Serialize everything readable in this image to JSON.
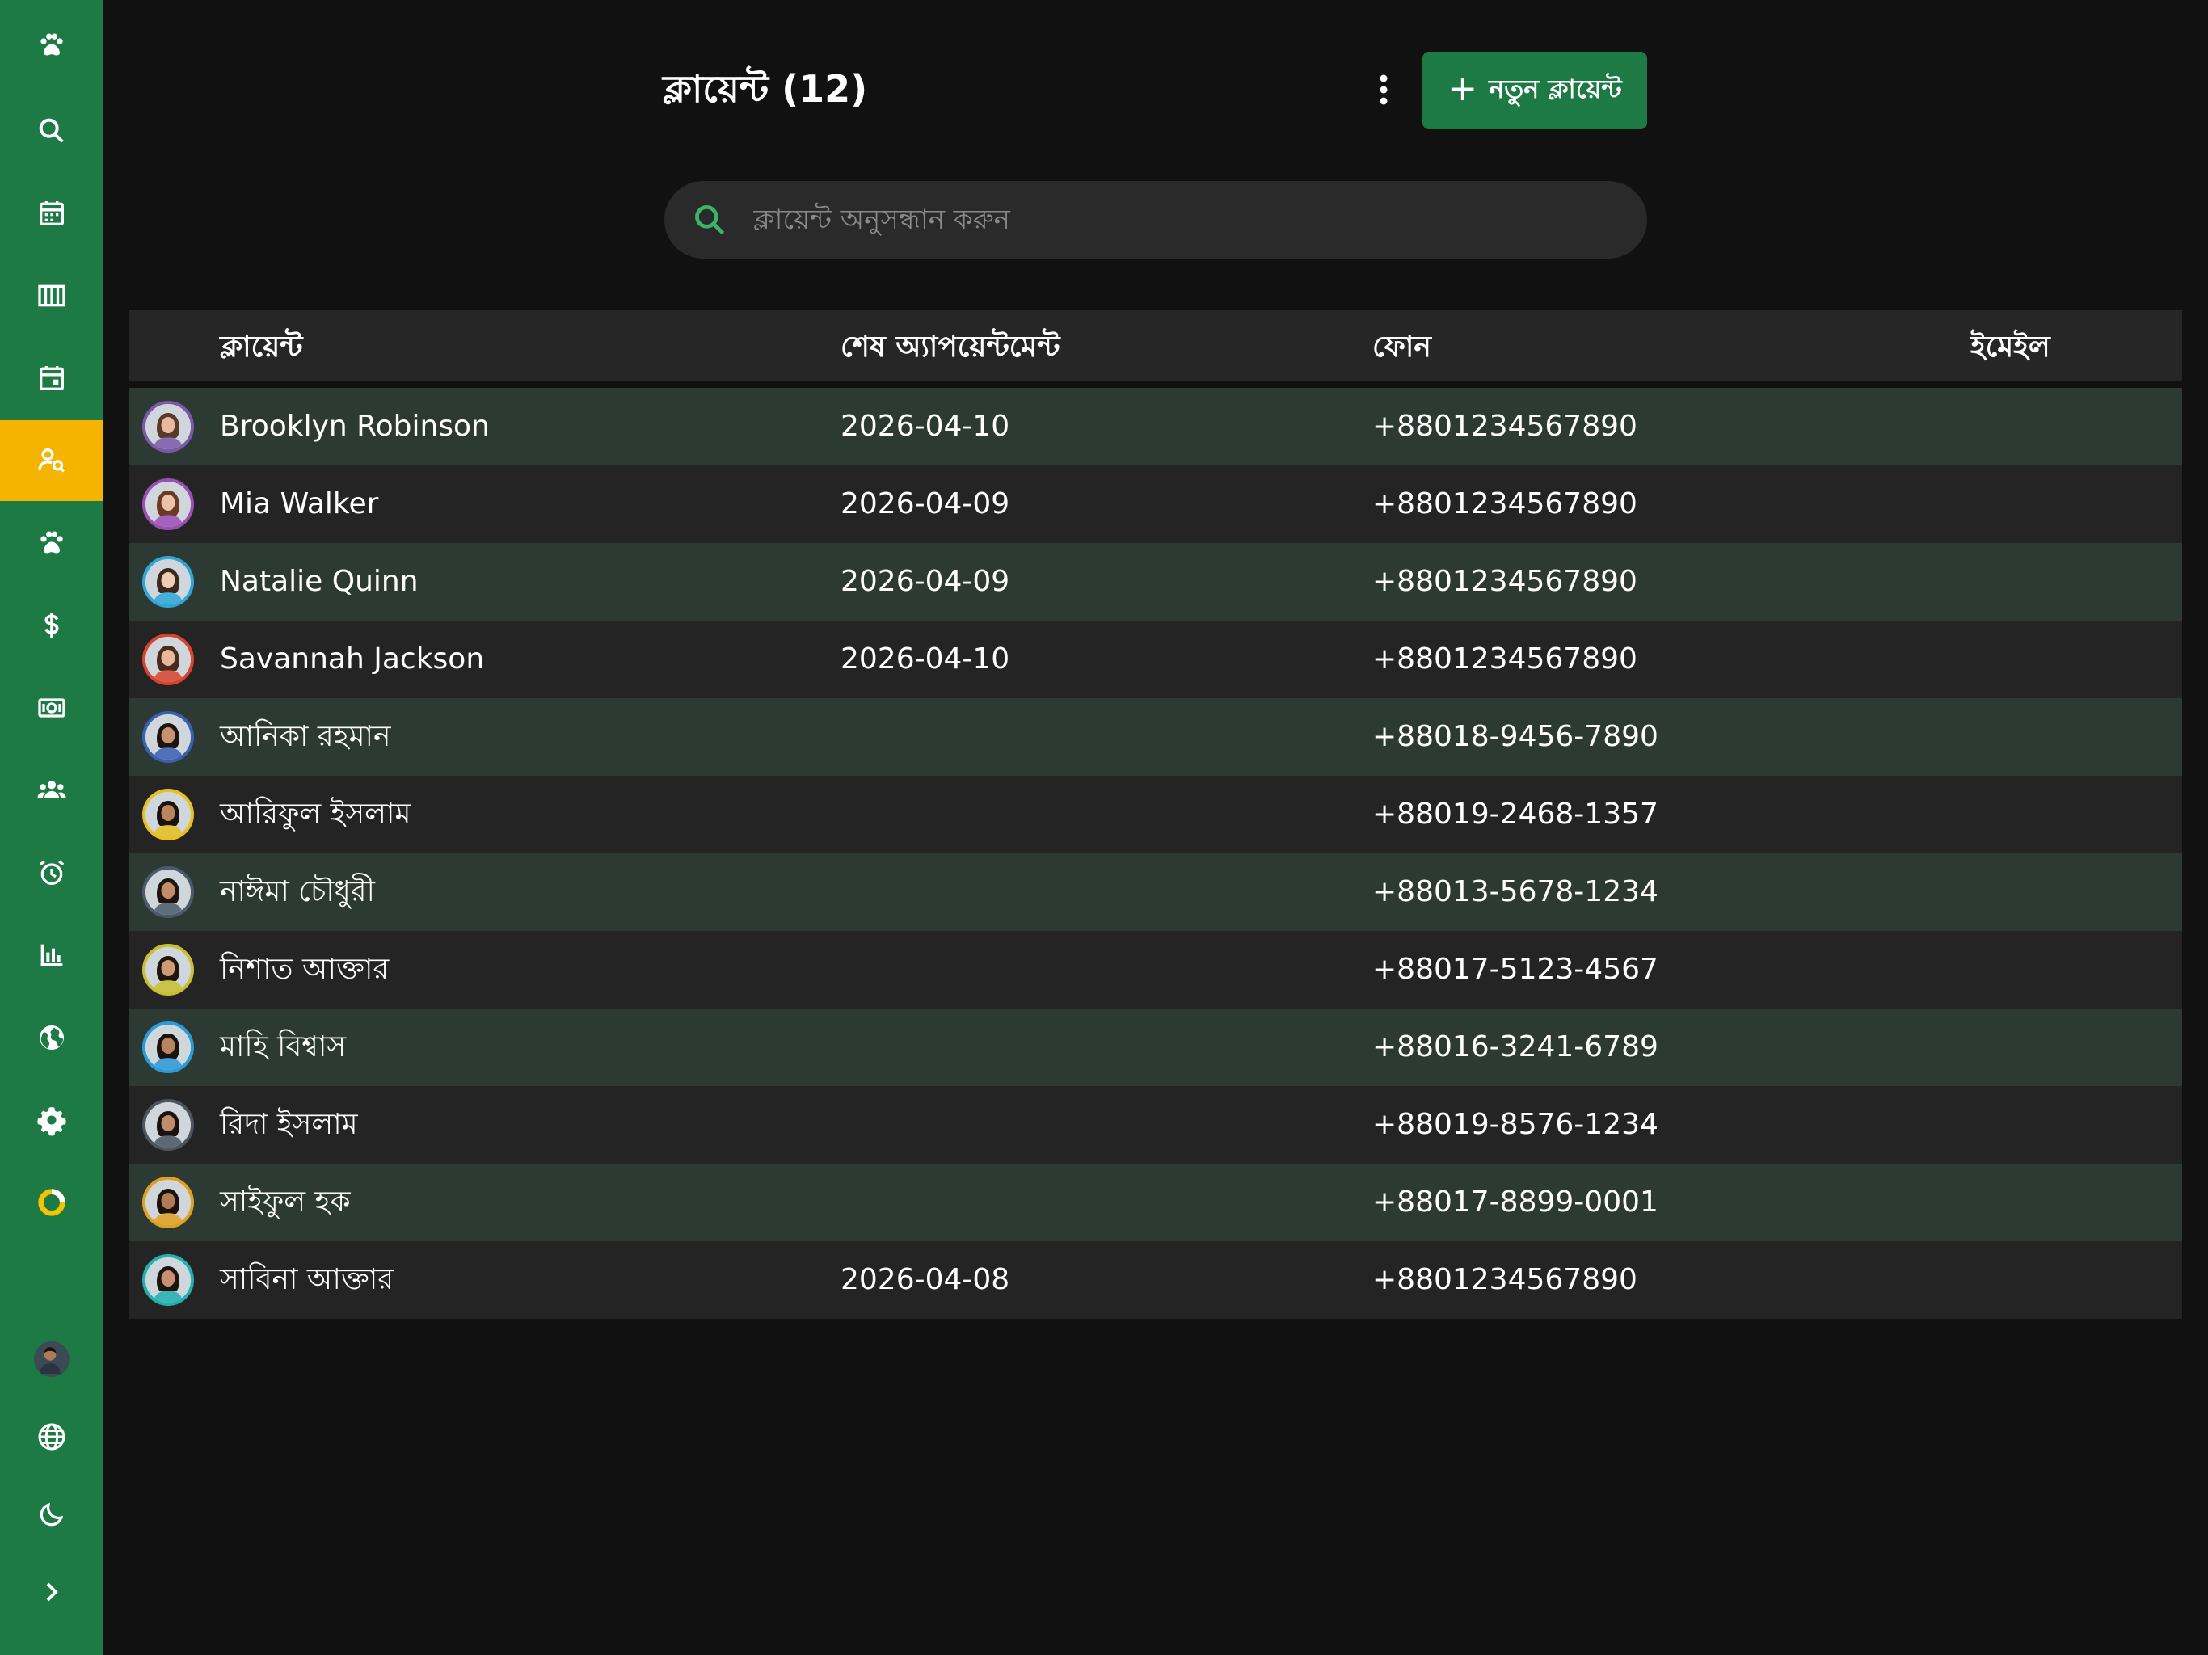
{
  "header": {
    "title": "ক্লায়েন্ট (12)",
    "new_button_label": "নতুন ক্লায়েন্ট",
    "new_button_icon": "plus-icon",
    "more_icon": "more-vertical-icon"
  },
  "search": {
    "placeholder": "ক্লায়েন্ট অনুসন্ধান করুন",
    "value": ""
  },
  "sidebar": {
    "items": [
      {
        "name": "paw-logo-icon",
        "active": false
      },
      {
        "name": "search-icon",
        "active": false
      },
      {
        "name": "calendar-icon",
        "active": false
      },
      {
        "name": "columns-icon",
        "active": false
      },
      {
        "name": "calendar-day-icon",
        "active": false
      },
      {
        "name": "client-search-icon",
        "active": true
      },
      {
        "name": "paw-icon",
        "active": false
      },
      {
        "name": "dollar-icon",
        "active": false
      },
      {
        "name": "cash-icon",
        "active": false
      },
      {
        "name": "team-icon",
        "active": false
      },
      {
        "name": "alarm-icon",
        "active": false
      },
      {
        "name": "bar-chart-icon",
        "active": false
      },
      {
        "name": "globe-icon",
        "active": false
      },
      {
        "name": "gear-icon",
        "active": false
      },
      {
        "name": "ring-icon",
        "active": false
      }
    ],
    "bottom": [
      {
        "name": "user-avatar"
      },
      {
        "name": "language-globe-icon"
      },
      {
        "name": "moon-icon"
      },
      {
        "name": "chevron-right-icon"
      }
    ]
  },
  "table": {
    "columns": [
      "ক্লায়েন্ট",
      "শেষ অ্যাপয়েন্টমেন্ট",
      "ফোন",
      "ইমেইল"
    ],
    "rows": [
      {
        "name": "Brooklyn Robinson",
        "last_appointment": "2026-04-10",
        "phone": "+8801234567890",
        "email": "",
        "ring_color": "#7a5aa8",
        "skin": "#e6b9a0",
        "hair": "#5a3a26"
      },
      {
        "name": "Mia Walker",
        "last_appointment": "2026-04-09",
        "phone": "+8801234567890",
        "email": "",
        "ring_color": "#9b4fb5",
        "skin": "#ecc2a8",
        "hair": "#6a3a22"
      },
      {
        "name": "Natalie Quinn",
        "last_appointment": "2026-04-09",
        "phone": "+8801234567890",
        "email": "",
        "ring_color": "#2fa6d8",
        "skin": "#f0cdb4",
        "hair": "#3a2a1e"
      },
      {
        "name": "Savannah Jackson",
        "last_appointment": "2026-04-10",
        "phone": "+8801234567890",
        "email": "",
        "ring_color": "#d8432f",
        "skin": "#e8b898",
        "hair": "#4a2a1c"
      },
      {
        "name": "আনিকা রহমান",
        "last_appointment": "",
        "phone": "+88018-9456-7890",
        "email": "",
        "ring_color": "#3a5fb0",
        "skin": "#c89270",
        "hair": "#1c1410"
      },
      {
        "name": "আরিফুল ইসলাম",
        "last_appointment": "",
        "phone": "+88019-2468-1357",
        "email": "",
        "ring_color": "#e8c020",
        "skin": "#b8855e",
        "hair": "#1a120c"
      },
      {
        "name": "নাঈমা চৌধুরী",
        "last_appointment": "",
        "phone": "+88013-5678-1234",
        "email": "",
        "ring_color": "#4a5a6a",
        "skin": "#c48d6a",
        "hair": "#1e1410"
      },
      {
        "name": "নিশাত আক্তার",
        "last_appointment": "",
        "phone": "+88017-5123-4567",
        "email": "",
        "ring_color": "#c8c030",
        "skin": "#d09a74",
        "hair": "#201610"
      },
      {
        "name": "মাহি বিশ্বাস",
        "last_appointment": "",
        "phone": "+88016-3241-6789",
        "email": "",
        "ring_color": "#2a9ad8",
        "skin": "#b88460",
        "hair": "#1a120c"
      },
      {
        "name": "রিদা ইসলাম",
        "last_appointment": "",
        "phone": "+88019-8576-1234",
        "email": "",
        "ring_color": "#4a5560",
        "skin": "#c08c6c",
        "hair": "#1a120e"
      },
      {
        "name": "সাইফুল হক",
        "last_appointment": "",
        "phone": "+88017-8899-0001",
        "email": "",
        "ring_color": "#e0a020",
        "skin": "#b07c58",
        "hair": "#1a120c"
      },
      {
        "name": "সাবিনা আক্তার",
        "last_appointment": "2026-04-08",
        "phone": "+8801234567890",
        "email": "",
        "ring_color": "#20b0b0",
        "skin": "#c89070",
        "hair": "#1c1410"
      }
    ]
  },
  "colors": {
    "sidebar_bg": "#1d7a45",
    "active_item": "#f5b400",
    "primary_button": "#1d7a45",
    "page_bg": "#111111",
    "row_odd": "#2c3a33",
    "row_even": "#242424"
  }
}
